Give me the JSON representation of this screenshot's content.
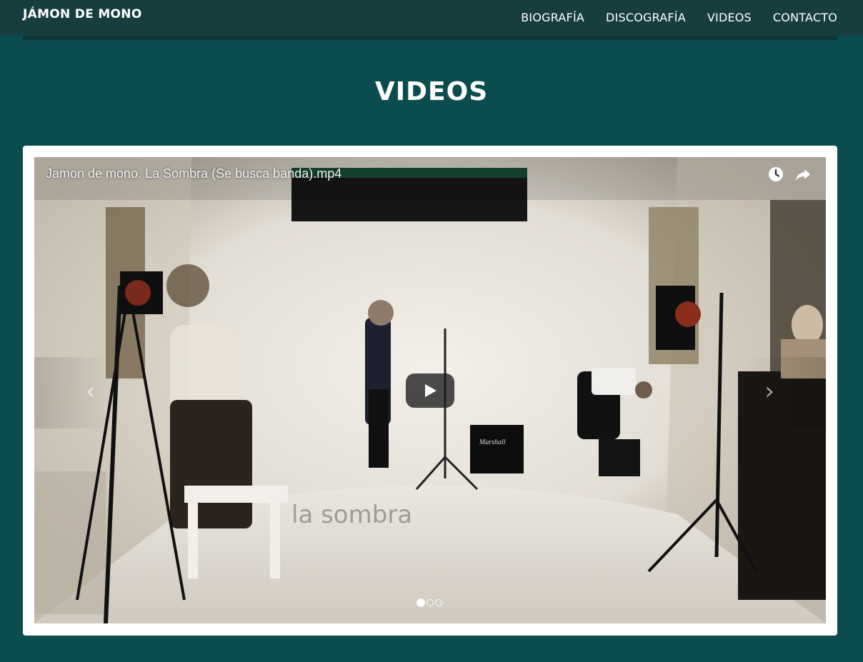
{
  "site": {
    "brand": "JÁMON DE MONO"
  },
  "nav": {
    "items": [
      {
        "label": "BIOGRAFÍA"
      },
      {
        "label": "DISCOGRAFÍA"
      },
      {
        "label": "VIDEOS"
      },
      {
        "label": "CONTACTO"
      }
    ]
  },
  "page": {
    "title": "VIDEOS"
  },
  "carousel": {
    "video_title": "Jamon de mono. La Sombra (Se busca banda).mp4",
    "overlay_text": "la sombra",
    "amp_brand": "Marshall",
    "slide_count": 3,
    "active_slide": 1,
    "icons": {
      "watch_later": "clock-icon",
      "share": "share-icon",
      "prev": "chevron-left-icon",
      "next": "chevron-right-icon"
    },
    "prev_glyph": "‹",
    "next_glyph": "›"
  },
  "colors": {
    "page_background": "#0b4d4e",
    "navbar_background": "#173e3f",
    "card_background": "#ffffff"
  }
}
